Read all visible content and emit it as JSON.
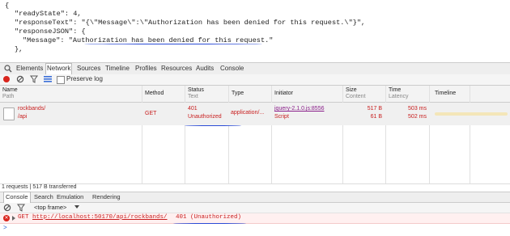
{
  "response_json": {
    "line1": "{",
    "line2": "\"readyState\": 4,",
    "line3": "\"responseText\": \"{\\\"Message\\\":\\\"Authorization has been denied for this request.\\\"}\",",
    "line4": "\"responseJSON\": {",
    "line5": "\"Message\": \"Authorization has been denied for this request.\"",
    "line6": "},"
  },
  "devtools_tabs": [
    "Elements",
    "Network",
    "Sources",
    "Timeline",
    "Profiles",
    "Resources",
    "Audits",
    "Console"
  ],
  "active_tab": "Network",
  "toolbar": {
    "preserve_log": "Preserve log"
  },
  "columns": {
    "name": "Name",
    "name_sub": "Path",
    "method": "Method",
    "status": "Status",
    "status_sub": "Text",
    "type": "Type",
    "initiator": "Initiator",
    "size": "Size",
    "size_sub": "Content",
    "time": "Time",
    "time_sub": "Latency",
    "timeline": "Timeline"
  },
  "request": {
    "name": "rockbands/",
    "path": "/api",
    "method": "GET",
    "status": "401",
    "status_text": "Unauthorized",
    "type": "application/...",
    "initiator": "jquery-2.1.0.js:8556",
    "initiator_sub": "Script",
    "size": "517 B",
    "content": "61 B",
    "time": "503 ms",
    "latency": "502 ms"
  },
  "status_bar": "1 requests  |  517 B transferred",
  "drawer_tabs": [
    "Console",
    "Search",
    "Emulation",
    "Rendering"
  ],
  "frame_select": "<top frame>",
  "console_message": {
    "method": "GET",
    "url": "http://localhost:50170/api/rockbands/",
    "code": "401 (Unauthorized)"
  },
  "prompt_symbol": ">",
  "colors": {
    "error": "#c81e1e",
    "annotation": "#2b4bd6",
    "link": "#8a1f8a"
  },
  "icons": [
    "search-icon",
    "record-icon",
    "clear-icon",
    "filter-icon",
    "list-view-icon",
    "checkbox-icon",
    "error-icon",
    "expand-triangle-icon",
    "dropdown-icon",
    "timeline-bar"
  ]
}
